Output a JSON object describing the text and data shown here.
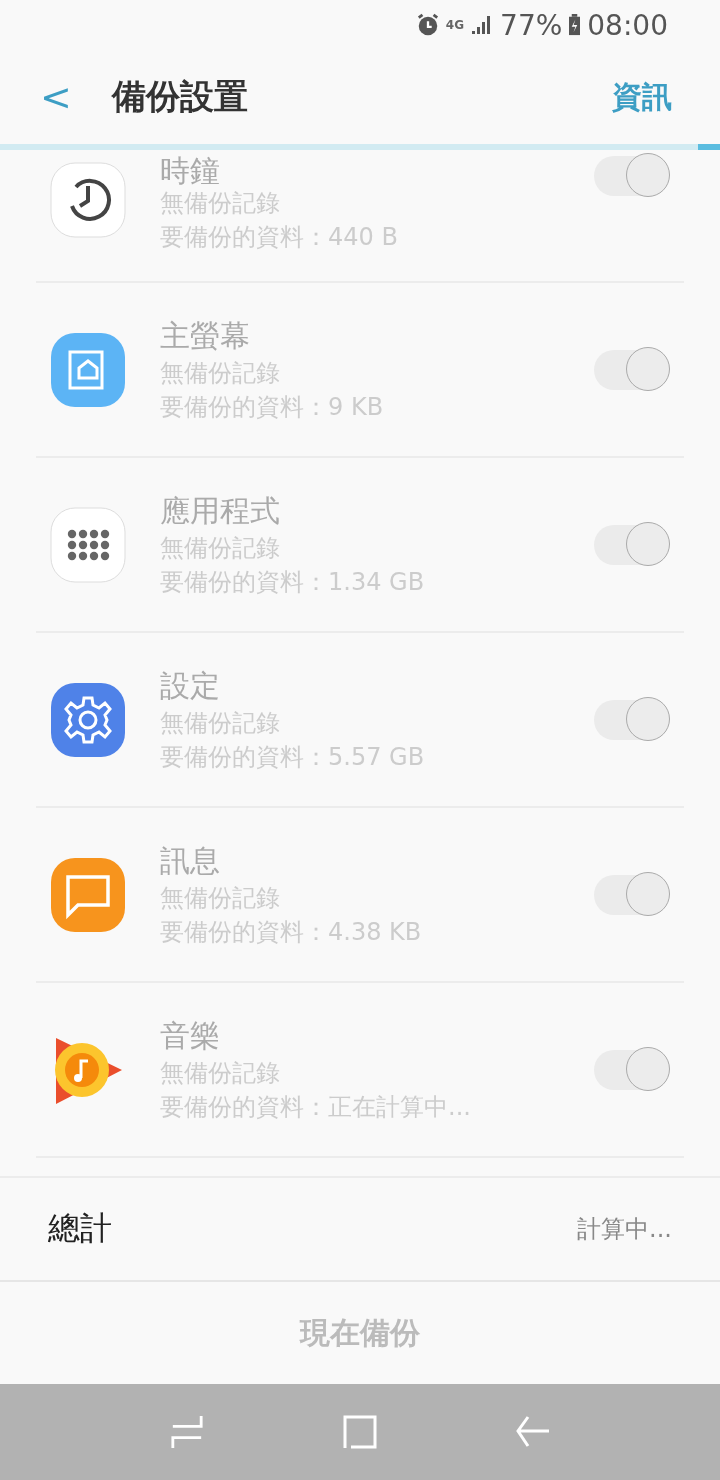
{
  "status_bar": {
    "network": "4G",
    "battery": "77%",
    "time": "08:00"
  },
  "header": {
    "back": "<",
    "title": "備份設置",
    "action": "資訊"
  },
  "progress": {
    "level": 0.97
  },
  "apps": [
    {
      "kind": "clock",
      "name": "時鐘",
      "history": "無備份記錄",
      "size": "要備份的資料：440 B",
      "on": true,
      "disabled": true
    },
    {
      "kind": "home",
      "name": "主螢幕",
      "history": "無備份記錄",
      "size": "要備份的資料：9 KB",
      "on": true,
      "disabled": true
    },
    {
      "kind": "apps",
      "name": "應用程式",
      "history": "無備份記錄",
      "size": "要備份的資料：1.34 GB",
      "on": true,
      "disabled": true
    },
    {
      "kind": "settings",
      "name": "設定",
      "history": "無備份記錄",
      "size": "要備份的資料：5.57 GB",
      "on": true,
      "disabled": true
    },
    {
      "kind": "messages",
      "name": "訊息",
      "history": "無備份記錄",
      "size": "要備份的資料：4.38 KB",
      "on": true,
      "disabled": true
    },
    {
      "kind": "music",
      "name": "音樂",
      "history": "無備份記錄",
      "size": "要備份的資料：正在計算中...",
      "on": true,
      "disabled": true
    }
  ],
  "total": {
    "label": "總計",
    "value": "計算中..."
  },
  "backup_button": {
    "label": "現在備份",
    "disabled": true
  }
}
